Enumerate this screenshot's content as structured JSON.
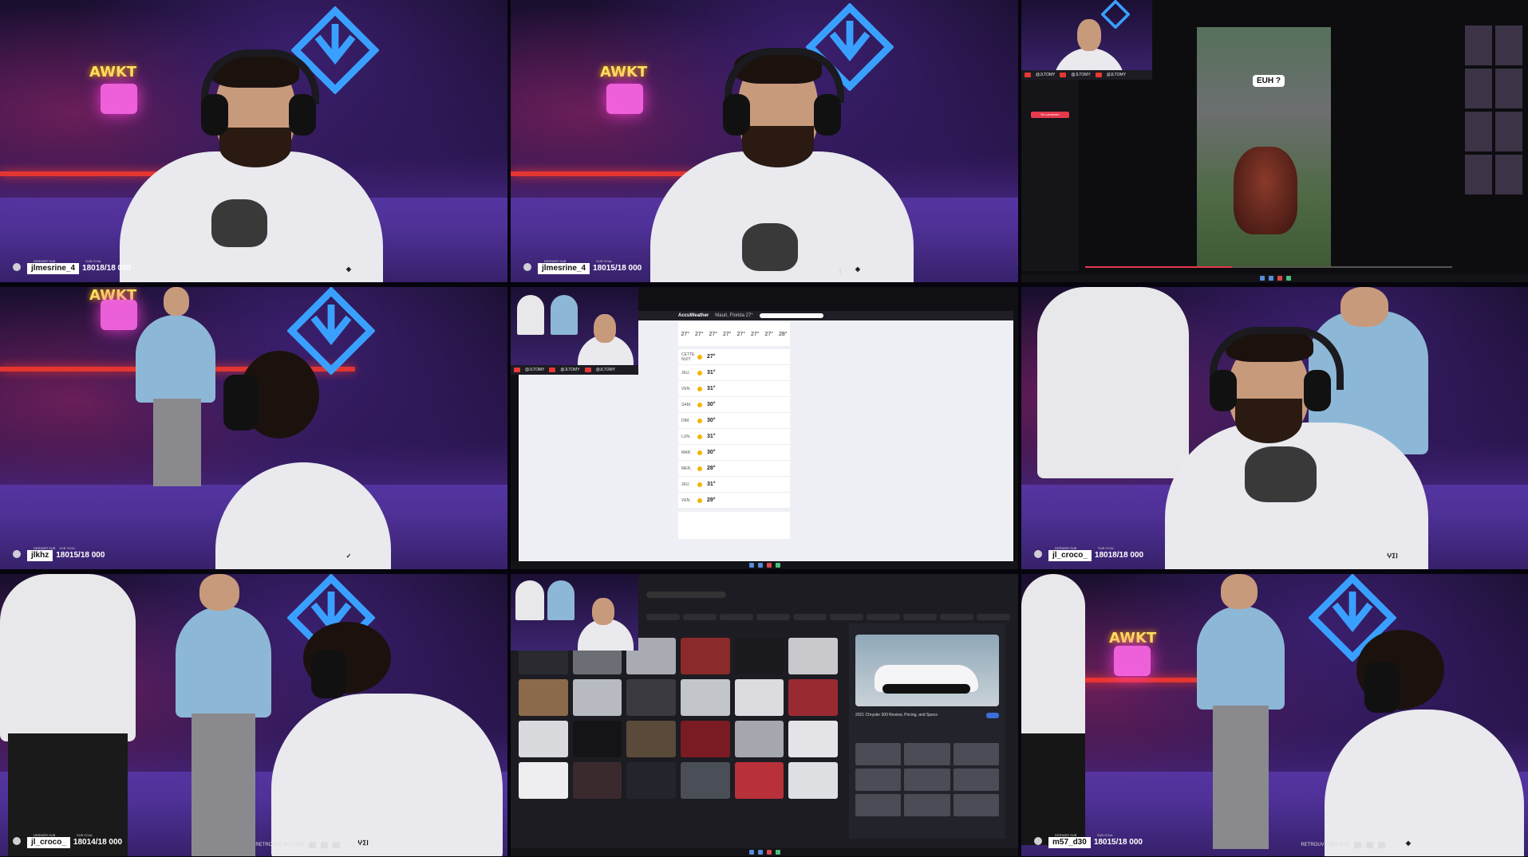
{
  "tiles": [
    {
      "type": "cam",
      "username": "jlmesrine_4",
      "sub_count": "18018/18 000",
      "top_left": "DERNIER SUB",
      "top_right": "SUB GOAL"
    },
    {
      "type": "cam",
      "username": "jlmesrine_4",
      "sub_count": "18015/18 000",
      "top_left": "DERNIER SUB",
      "top_right": "SUB GOAL"
    },
    {
      "type": "screen-gta",
      "speech": "EUH ?",
      "side_button": "Se connecter",
      "cam_labels": [
        "@JLTOMY",
        "@JLTOMY",
        "@JLTOMY"
      ]
    },
    {
      "type": "cam",
      "username": "jlkhz",
      "sub_count": "18015/18 000",
      "top_left": "DERNIER SUB",
      "top_right": "SUB GOAL"
    },
    {
      "type": "screen-weather",
      "app": "AccuWeather",
      "location": "Mauri, Florida 27°",
      "temps": [
        "27°",
        "27°",
        "27°",
        "27°",
        "27°",
        "27°",
        "27°",
        "28°"
      ],
      "list_temps": [
        "27°",
        "31°",
        "31°",
        "30°",
        "30°",
        "31°",
        "30°",
        "28°",
        "31°",
        "29°"
      ],
      "days": [
        "CETTE NUIT",
        "JEU.",
        "VEN.",
        "SAM.",
        "DIM.",
        "LUN.",
        "MAR.",
        "MER.",
        "JEU.",
        "VEN."
      ],
      "cam_labels": [
        "@JLTOMY",
        "@JLTOMY",
        "@JLTOMY"
      ]
    },
    {
      "type": "cam",
      "username": "jl_croco_",
      "sub_count": "18018/18 000",
      "top_left": "DERNIER SUB",
      "top_right": "SUB GOAL",
      "badge": "ⵖⵉⵏ"
    },
    {
      "type": "cam",
      "username": "jl_croco_",
      "sub_count": "18014/18 000",
      "top_left": "DERNIER SUB",
      "top_right": "SUB GOAL",
      "right_text": "RETROUVE MOI SUR",
      "badge": "ⵖⵉⵏ"
    },
    {
      "type": "screen-images",
      "preview_title": "2021 Chrysler 300 Review, Pricing, and Specs"
    },
    {
      "type": "cam",
      "username": "m57_d30",
      "sub_count": "18015/18 000",
      "top_left": "DERNIER SUB",
      "top_right": "SUB GOAL",
      "right_text": "RETROUVE MOI SUR"
    }
  ],
  "colors": {
    "neon_blue": "#3aa0ff",
    "neon_red": "#ff3a2a",
    "neon_pink": "#ff3fd6",
    "accent_red": "#e5394d"
  },
  "icons": [
    "user-icon",
    "twitter-icon",
    "youtube-icon",
    "instagram-icon",
    "logo-diamond-icon"
  ]
}
